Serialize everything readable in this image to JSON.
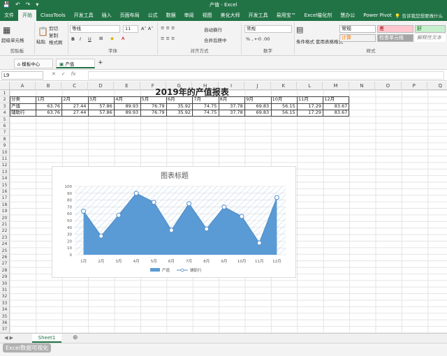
{
  "window": {
    "doc_title": "产值 - Excel"
  },
  "ribbon_tabs": [
    "文件",
    "开始",
    "ClassTools",
    "开发工具",
    "插入",
    "页面布局",
    "公式",
    "数据",
    "审阅",
    "视图",
    "美化大师",
    "开发工具",
    "易用宝™",
    "Excel催化剂",
    "慧办公",
    "Power Pivot"
  ],
  "tell_me": "告诉我您想要做什么",
  "ribbon": {
    "clipboard": {
      "label": "剪贴板",
      "paste": "粘贴",
      "cut": "剪切",
      "copy": "复制",
      "format_painter": "格式刷",
      "tool": "超级单元格"
    },
    "font": {
      "label": "字体",
      "name": "等线",
      "size": "11",
      "bold": "B",
      "italic": "I",
      "underline": "U"
    },
    "alignment": {
      "label": "对齐方式",
      "wrap": "自动换行",
      "merge": "合并后居中"
    },
    "number": {
      "label": "数字",
      "format": "常规"
    },
    "styles": {
      "label": "样式",
      "cond_format": "条件格式",
      "table_format": "套用表格格式",
      "normal": "常规",
      "bad": "差",
      "good": "好",
      "calc": "计算",
      "check": "检查单元格",
      "explain": "解释性文本"
    }
  },
  "doc_tabs": {
    "template": "模板中心",
    "file": "产值"
  },
  "formula_bar": {
    "name_box": "L9",
    "fx": "fx",
    "cancel": "✕",
    "enter": "✓",
    "value": ""
  },
  "columns": [
    "A",
    "B",
    "C",
    "D",
    "E",
    "F",
    "G",
    "H",
    "I",
    "J",
    "K",
    "L",
    "M",
    "N",
    "O",
    "P",
    "Q"
  ],
  "rows": [
    "1",
    "2",
    "3",
    "4",
    "5",
    "6",
    "7",
    "8",
    "9",
    "10",
    "11",
    "12",
    "13",
    "14",
    "15",
    "16",
    "17",
    "18",
    "19",
    "20",
    "21",
    "22",
    "23",
    "24",
    "25",
    "26",
    "27",
    "28",
    "29",
    "30",
    "31",
    "32",
    "33",
    "34",
    "35",
    "36",
    "37"
  ],
  "sheet": {
    "title": "2019年的产值报表",
    "header": [
      "分类",
      "1月",
      "2月",
      "3月",
      "4月",
      "5月",
      "6月",
      "7月",
      "8月",
      "9月",
      "10月",
      "11月",
      "12月"
    ],
    "rows": [
      {
        "label": "产值",
        "values": [
          "63.76",
          "27.44",
          "57.86",
          "89.93",
          "76.79",
          "35.92",
          "74.75",
          "37.78",
          "69.83",
          "56.15",
          "17.29",
          "83.67"
        ]
      },
      {
        "label": "辅助行",
        "values": [
          "63.76",
          "27.44",
          "57.86",
          "89.93",
          "76.79",
          "35.92",
          "74.75",
          "37.78",
          "69.83",
          "56.15",
          "17.29",
          "83.67"
        ]
      }
    ]
  },
  "chart_data": {
    "type": "area",
    "title": "图表标题",
    "categories": [
      "1月",
      "2月",
      "3月",
      "4月",
      "5月",
      "6月",
      "7月",
      "8月",
      "9月",
      "10月",
      "11月",
      "12月"
    ],
    "series": [
      {
        "name": "产值",
        "type": "area",
        "values": [
          63.76,
          27.44,
          57.86,
          89.93,
          76.79,
          35.92,
          74.75,
          37.78,
          69.83,
          56.15,
          17.29,
          83.67
        ]
      },
      {
        "name": "辅助行",
        "type": "line",
        "values": [
          63.76,
          27.44,
          57.86,
          89.93,
          76.79,
          35.92,
          74.75,
          37.78,
          69.83,
          56.15,
          17.29,
          83.67
        ]
      }
    ],
    "yticks": [
      "0",
      "10",
      "20",
      "30",
      "40",
      "50",
      "60",
      "70",
      "80",
      "90",
      "100"
    ],
    "ylim": [
      0,
      100
    ],
    "grid": true,
    "legend": "bottom",
    "colors": {
      "area": "#5b9bd5",
      "line": "#4f8ecb",
      "marker_fill": "#ffffff"
    }
  },
  "sheet_tab": "Sheet1",
  "watermark": "Excel数据可视化"
}
